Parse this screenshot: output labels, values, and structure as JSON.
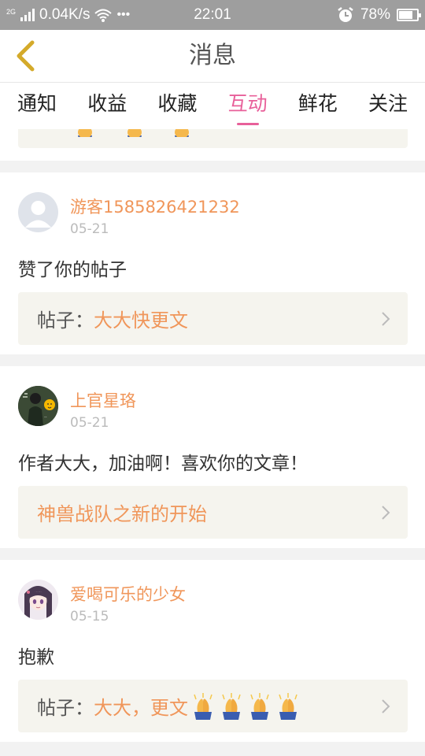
{
  "status_bar": {
    "network": "2G",
    "speed": "0.04K/s",
    "dots": "•••",
    "time": "22:01",
    "battery_percent": "78%",
    "battery_level": 0.78
  },
  "header": {
    "title": "消息"
  },
  "tabs": [
    {
      "label": "通知",
      "active": false
    },
    {
      "label": "收益",
      "active": false
    },
    {
      "label": "收藏",
      "active": false
    },
    {
      "label": "互动",
      "active": true
    },
    {
      "label": "鲜花",
      "active": false
    },
    {
      "label": "关注",
      "active": false
    }
  ],
  "messages": [
    {
      "username": "游客1585826421232",
      "date": "05-21",
      "content": "赞了你的帖子",
      "ref_prefix": "帖子：",
      "ref_title": "大大快更文",
      "ref_emoji_count": 0,
      "avatar": "default-avatar-icon"
    },
    {
      "username": "上官星珞",
      "date": "05-21",
      "content": "作者大大，加油啊！喜欢你的文章！",
      "ref_prefix": "",
      "ref_title": "神兽战队之新的开始",
      "ref_emoji_count": 0,
      "avatar": "photo-avatar"
    },
    {
      "username": "爱喝可乐的少女",
      "date": "05-15",
      "content": "抱歉",
      "ref_prefix": "帖子：",
      "ref_title": "大大，更文",
      "ref_emoji_count": 4,
      "avatar": "anime-avatar"
    }
  ],
  "colors": {
    "accent": "#e8609a",
    "username": "#f0965a",
    "back_arrow": "#d4aa2a",
    "ref_bg": "#f5f4ee",
    "status_bar": "#9e9e9e"
  }
}
